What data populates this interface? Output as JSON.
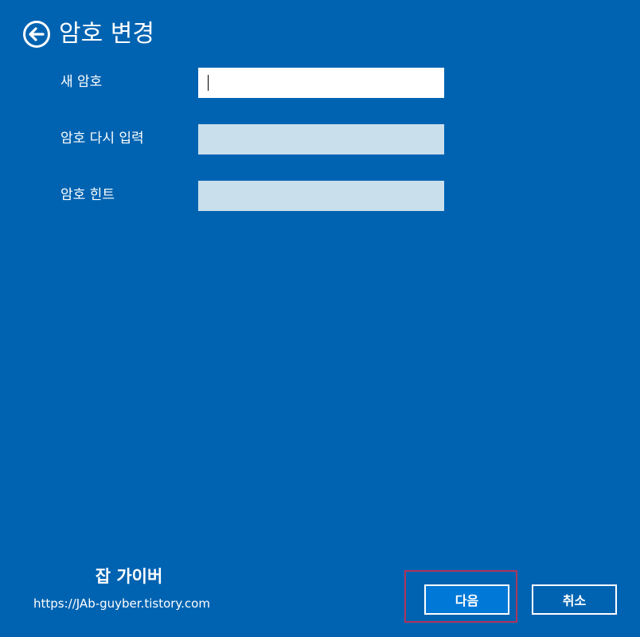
{
  "header": {
    "title": "암호 변경",
    "back_icon": "back-arrow-circle-icon"
  },
  "form": {
    "fields": [
      {
        "label": "새 암호",
        "value": ""
      },
      {
        "label": "암호 다시 입력",
        "value": ""
      },
      {
        "label": "암호 힌트",
        "value": ""
      }
    ]
  },
  "watermark": {
    "title": "잡 가이버",
    "url": "https://JAb-guyber.tistory.com"
  },
  "buttons": {
    "next_label": "다음",
    "cancel_label": "취소"
  },
  "colors": {
    "background": "#0063b1",
    "field_active": "#ffffff",
    "field_inactive": "#c9dfec",
    "highlight": "#b0345a"
  }
}
